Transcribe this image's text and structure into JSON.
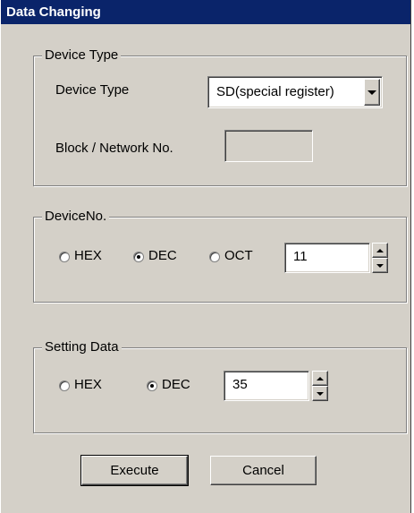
{
  "window": {
    "title": "Data Changing"
  },
  "device_type_group": {
    "legend": "Device Type",
    "device_type_label": "Device Type",
    "device_type_value": "SD(special register)",
    "block_label": "Block / Network No.",
    "block_value": ""
  },
  "device_no_group": {
    "legend": "DeviceNo.",
    "radios": [
      {
        "label": "HEX",
        "checked": false
      },
      {
        "label": "DEC",
        "checked": true
      },
      {
        "label": "OCT",
        "checked": false
      }
    ],
    "value": "11"
  },
  "setting_data_group": {
    "legend": "Setting Data",
    "radios": [
      {
        "label": "HEX",
        "checked": false
      },
      {
        "label": "DEC",
        "checked": true
      }
    ],
    "value": "35"
  },
  "buttons": {
    "execute": "Execute",
    "cancel": "Cancel"
  },
  "colors": {
    "title_bar": "#0a246a",
    "dialog_face": "#d4d0c8"
  }
}
